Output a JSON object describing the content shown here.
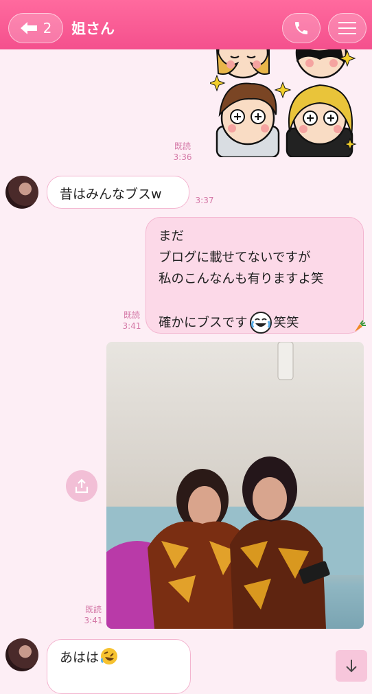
{
  "header": {
    "back_count": "2",
    "title": "姐さん"
  },
  "messages": [
    {
      "read": "既読",
      "time": "3:36"
    },
    {
      "text": "昔はみんなブスw",
      "time": "3:37"
    },
    {
      "lines": [
        "まだ",
        "ブログに載せてないですが",
        "私のこんなんも有りますよ笑",
        "",
        "確かにブスです",
        "笑笑"
      ],
      "read": "既読",
      "time": "3:41"
    },
    {
      "read": "既読",
      "time": "3:41"
    },
    {
      "text": "あはは"
    }
  ],
  "icons": {
    "back": "back-arrow-icon",
    "call": "phone-icon",
    "menu": "hamburger-icon",
    "share": "share-icon",
    "down": "arrow-down-icon",
    "laugh_cry": "laughing-crying-emoji-icon",
    "rofl": "rofl-emoji-icon",
    "carrot": "carrot-icon"
  },
  "colors": {
    "header": "#f4508d",
    "background": "#fdeef5",
    "outgoing_bubble": "#fcd9e8",
    "timestamp": "#d477a6"
  }
}
